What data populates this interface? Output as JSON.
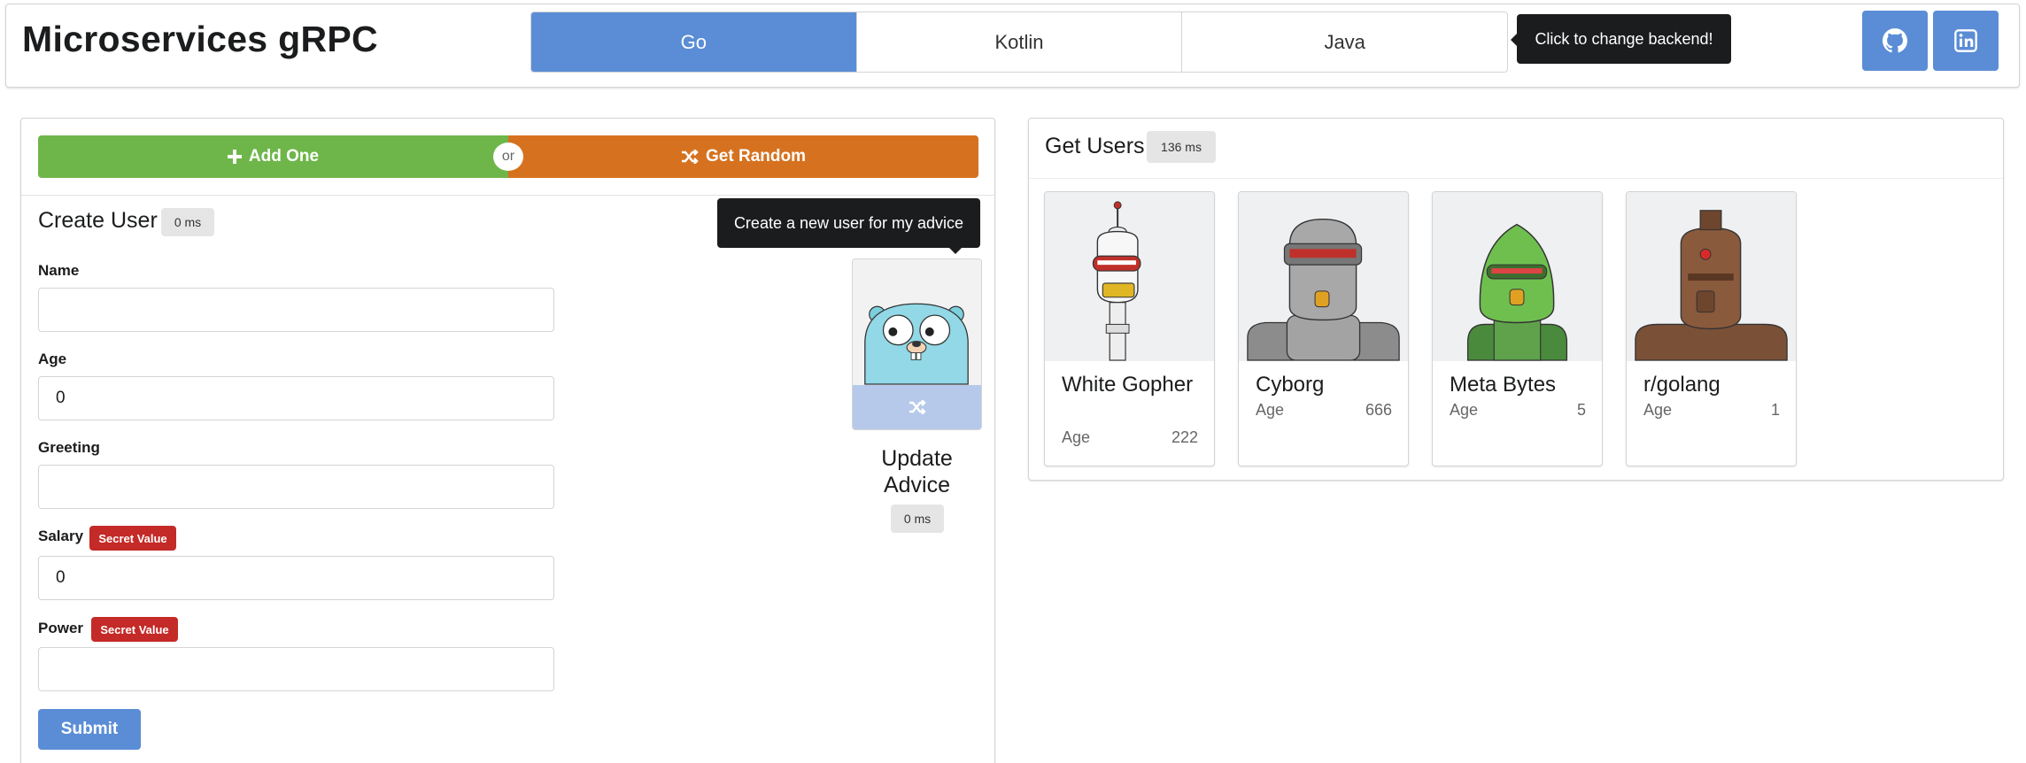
{
  "header": {
    "title": "Microservices gRPC",
    "backends": [
      {
        "label": "Go",
        "active": true
      },
      {
        "label": "Kotlin",
        "active": false
      },
      {
        "label": "Java",
        "active": false
      }
    ],
    "backend_tooltip": "Click to change backend!",
    "github_icon": "github-icon",
    "linkedin_icon": "linkedin-icon"
  },
  "actions": {
    "add_label": "Add One",
    "or_label": "or",
    "random_label": "Get Random"
  },
  "create_user": {
    "title": "Create User",
    "timing": "0 ms",
    "fields": {
      "name": {
        "label": "Name",
        "value": ""
      },
      "age": {
        "label": "Age",
        "value": "0"
      },
      "greeting": {
        "label": "Greeting",
        "value": ""
      },
      "salary": {
        "label": "Salary",
        "value": "0",
        "badge": "Secret Value"
      },
      "power": {
        "label": "Power",
        "value": "",
        "badge": "Secret Value"
      }
    },
    "submit_label": "Submit"
  },
  "advice": {
    "tooltip": "Create a new user for my advice",
    "title": "Update Advice",
    "timing": "0 ms"
  },
  "get_users": {
    "title": "Get Users",
    "timing": "136 ms",
    "age_label": "Age",
    "users": [
      {
        "name": "White Gopher",
        "age": "222"
      },
      {
        "name": "Cyborg",
        "age": "666"
      },
      {
        "name": "Meta Bytes",
        "age": "5"
      },
      {
        "name": "r/golang",
        "age": "1"
      }
    ]
  },
  "colors": {
    "primary": "#5b8dd6",
    "add_green": "#6eb64a",
    "random_orange": "#d6721f",
    "secret_red": "#c42a27"
  }
}
